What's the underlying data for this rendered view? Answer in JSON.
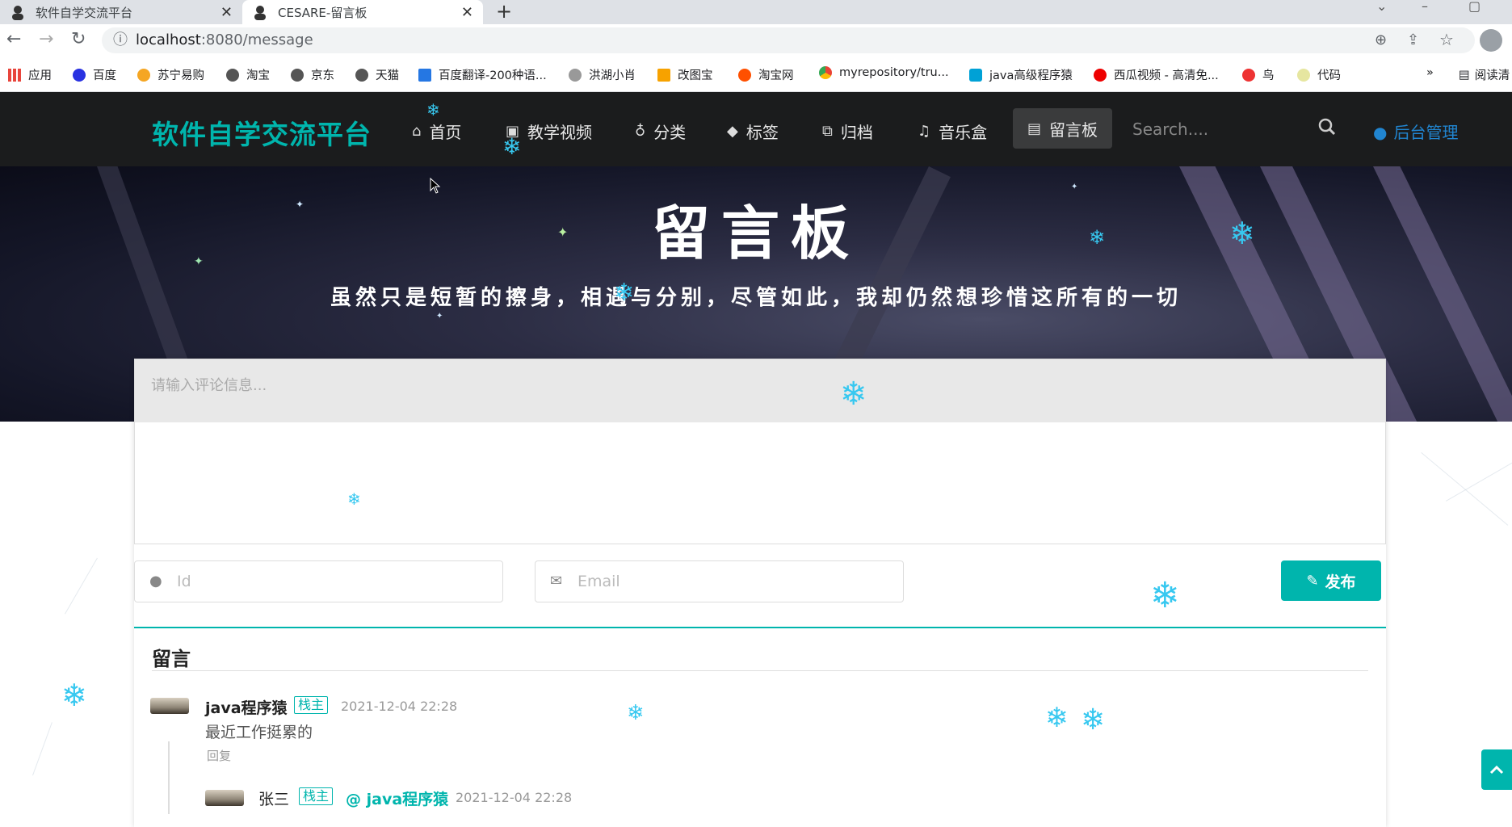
{
  "browser": {
    "tabs": [
      {
        "title": "软件自学交流平台",
        "active": false
      },
      {
        "title": "CESARE-留言板",
        "active": true
      }
    ],
    "url_host": "localhost",
    "url_path": ":8080/message",
    "bookmarks": [
      "应用",
      "百度",
      "苏宁易购",
      "淘宝",
      "京东",
      "天猫",
      "百度翻译-200种语...",
      "洪湖小肖",
      "改图宝",
      "淘宝网",
      "myrepository/tru...",
      "java高级程序猿",
      "西瓜视频 - 高清免...",
      "鸟",
      "代码"
    ],
    "bookmark_overflow": "»",
    "reading_list": "阅读清"
  },
  "nav": {
    "brand": "软件自学交流平台",
    "items": [
      {
        "icon": "home-icon",
        "glyph": "⌂",
        "label": "首页"
      },
      {
        "icon": "image-icon",
        "glyph": "▣",
        "label": "教学视频"
      },
      {
        "icon": "lightbulb-icon",
        "glyph": "♁",
        "label": "分类"
      },
      {
        "icon": "tags-icon",
        "glyph": "◆",
        "label": "标签"
      },
      {
        "icon": "clone-icon",
        "glyph": "⧉",
        "label": "归档"
      },
      {
        "icon": "music-icon",
        "glyph": "♫",
        "label": "音乐盒"
      },
      {
        "icon": "book-icon",
        "glyph": "▤",
        "label": "留言板"
      }
    ],
    "search_placeholder": "Search....",
    "admin_label": "后台管理"
  },
  "hero": {
    "title": "留言板",
    "subtitle": "虽然只是短暂的擦身，相遇与分别，尽管如此，我却仍然想珍惜这所有的一切"
  },
  "form": {
    "textarea_placeholder": "请输入评论信息...",
    "id_placeholder": "Id",
    "email_placeholder": "Email",
    "publish_label": "发布"
  },
  "comments": {
    "section_title": "留言",
    "items": [
      {
        "name": "java程序猿",
        "badge": "栈主",
        "time": "2021-12-04 22:28",
        "text": "最近工作挺累的",
        "reply": "回复"
      }
    ],
    "replies": [
      {
        "name": "张三",
        "badge": "栈主",
        "at": "@ java程序猿",
        "time": "2021-12-04 22:28"
      }
    ]
  },
  "colors": {
    "accent": "#00b5ad",
    "nav_bg": "#1b1c1d",
    "link": "#2185d0",
    "snow": "#37c8f0"
  }
}
